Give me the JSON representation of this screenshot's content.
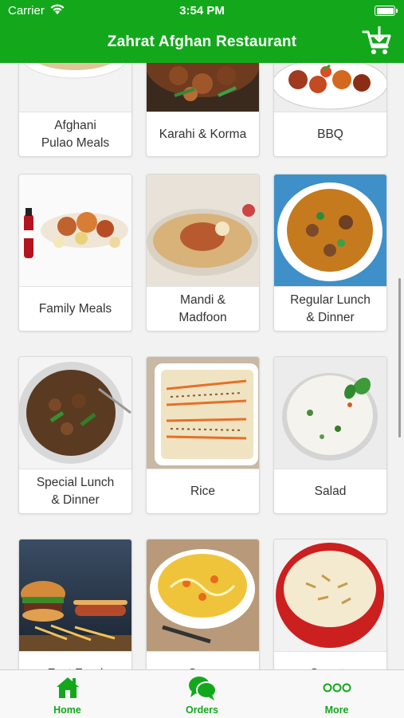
{
  "status_bar": {
    "carrier": "Carrier",
    "time": "3:54 PM"
  },
  "header": {
    "title": "Zahrat Afghan Restaurant"
  },
  "categories": [
    {
      "label": "Afghani\nPulao Meals"
    },
    {
      "label": "Karahi & Korma"
    },
    {
      "label": "BBQ"
    },
    {
      "label": "Family Meals"
    },
    {
      "label": "Mandi &\nMadfoon"
    },
    {
      "label": "Regular Lunch\n& Dinner"
    },
    {
      "label": "Special Lunch\n& Dinner"
    },
    {
      "label": "Rice"
    },
    {
      "label": "Salad"
    },
    {
      "label": "Fast Food"
    },
    {
      "label": "Soup"
    },
    {
      "label": "Sweets"
    }
  ],
  "tabbar": {
    "items": [
      {
        "label": "Home",
        "icon": "home-icon"
      },
      {
        "label": "Orders",
        "icon": "chat-bubbles-icon"
      },
      {
        "label": "More",
        "icon": "more-dots-icon"
      }
    ]
  },
  "colors": {
    "brand_green": "#13a81c"
  }
}
